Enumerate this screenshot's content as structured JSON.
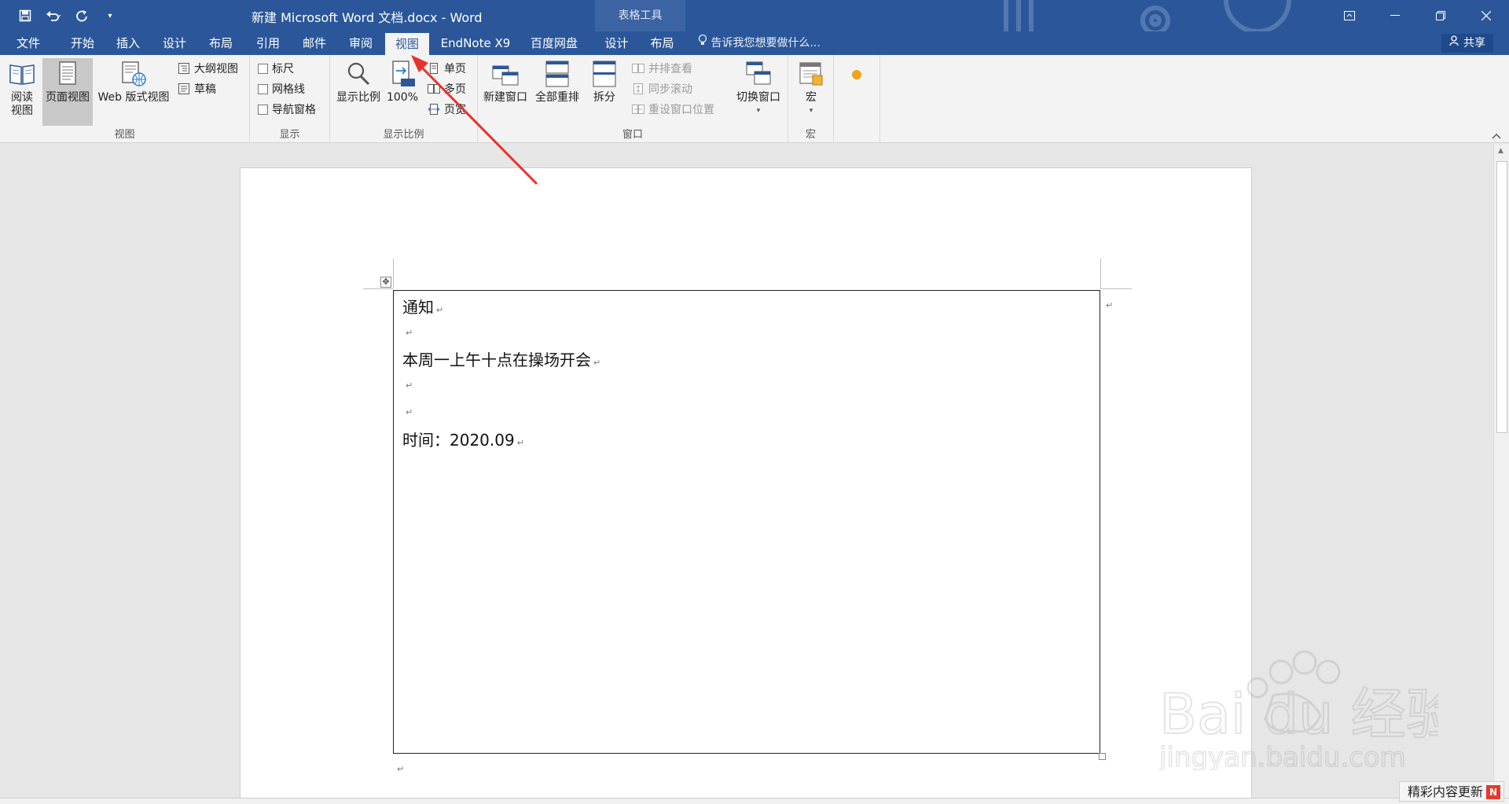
{
  "window": {
    "title": "新建 Microsoft Word 文档.docx - Word",
    "context_tab": "表格工具",
    "share_label": "共享"
  },
  "menu": {
    "tabs": [
      "文件",
      "开始",
      "插入",
      "设计",
      "布局",
      "引用",
      "邮件",
      "审阅",
      "视图",
      "EndNote X9",
      "百度网盘",
      "设计",
      "布局"
    ],
    "active_tab": "视图",
    "tell_me": "告诉我您想要做什么..."
  },
  "ribbon": {
    "views": {
      "label": "视图",
      "read_mode": "阅读\n视图",
      "print_layout": "页面视图",
      "web_layout": "Web 版式视图",
      "outline": "大纲视图",
      "draft": "草稿"
    },
    "show": {
      "label": "显示",
      "ruler": "标尺",
      "gridlines": "网格线",
      "nav_pane": "导航窗格"
    },
    "zoom": {
      "label": "显示比例",
      "zoom": "显示比例",
      "hundred": "100%",
      "one_page": "单页",
      "multi_page": "多页",
      "page_width": "页宽"
    },
    "window": {
      "label": "窗口",
      "new_window": "新建窗口",
      "arrange_all": "全部重排",
      "split": "拆分",
      "side_by_side": "并排查看",
      "sync_scroll": "同步滚动",
      "reset_position": "重设窗口位置",
      "switch_windows": "切换窗口"
    },
    "macros": {
      "label": "宏",
      "macros": "宏"
    }
  },
  "document": {
    "lines": [
      "通知",
      "本周一上午十点在操场开会",
      "时间：2020.09"
    ],
    "paragraph_mark": "↵"
  },
  "status": {
    "update_text": "精彩内容更新",
    "badge_letter": "N"
  },
  "watermark": {
    "text": "Bai du 经验",
    "url": "jingyan.baidu.com"
  },
  "colors": {
    "ribbon_blue": "#2b579a",
    "annotation_red": "#e8322b"
  }
}
